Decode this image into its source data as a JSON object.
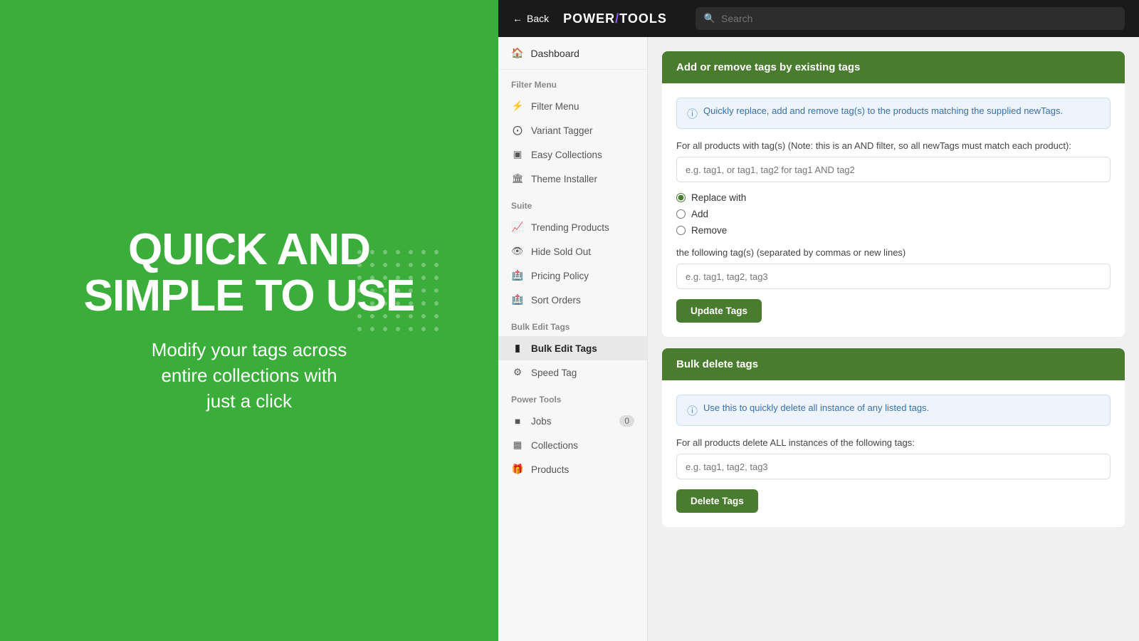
{
  "left": {
    "title_line1": "QUICK AND",
    "title_line2": "SIMPLE TO USE",
    "subtitle_line1": "Modify your tags across",
    "subtitle_line2": "entire collections with",
    "subtitle_line3": "just a click"
  },
  "topbar": {
    "back_label": "Back",
    "logo": "POWER",
    "logo_slash": "/",
    "logo_end": "TOOLS",
    "search_placeholder": "Search"
  },
  "sidebar": {
    "dashboard_label": "Dashboard",
    "filter_menu_header": "Filter Menu",
    "filter_menu_items": [
      {
        "label": "Filter Menu",
        "icon": "filter"
      },
      {
        "label": "Variant Tagger",
        "icon": "tag"
      },
      {
        "label": "Easy Collections",
        "icon": "collection"
      },
      {
        "label": "Theme Installer",
        "icon": "theme"
      }
    ],
    "suite_header": "Suite",
    "suite_items": [
      {
        "label": "Trending Products",
        "icon": "trending"
      },
      {
        "label": "Hide Sold Out",
        "icon": "hide"
      },
      {
        "label": "Pricing Policy",
        "icon": "pricing"
      },
      {
        "label": "Sort Orders",
        "icon": "sort"
      }
    ],
    "bulk_edit_header": "Bulk Edit Tags",
    "bulk_edit_items": [
      {
        "label": "Bulk Edit Tags",
        "icon": "bulk",
        "active": true
      },
      {
        "label": "Speed Tag",
        "icon": "speed"
      }
    ],
    "power_tools_header": "Power Tools",
    "power_tools_items": [
      {
        "label": "Jobs",
        "icon": "jobs",
        "badge": "0"
      },
      {
        "label": "Collections",
        "icon": "collections"
      },
      {
        "label": "Products",
        "icon": "products"
      }
    ]
  },
  "main": {
    "add_remove_section": {
      "header": "Add or remove tags by existing tags",
      "info_text": "Quickly replace, add and remove tag(s) to the products matching the supplied newTags.",
      "existing_tags_label": "For all products with tag(s) (Note: this is an AND filter, so all newTags must match each product):",
      "existing_tags_placeholder": "e.g. tag1, or tag1, tag2 for tag1 AND tag2",
      "radio_options": [
        "Replace with",
        "Add",
        "Remove"
      ],
      "radio_selected": "Replace with",
      "following_tags_label": "the following tag(s) (separated by commas or new lines)",
      "following_tags_placeholder": "e.g. tag1, tag2, tag3",
      "update_button": "Update Tags"
    },
    "bulk_delete_section": {
      "header": "Bulk delete tags",
      "info_text": "Use this to quickly delete all instance of any listed tags.",
      "delete_label": "For all products delete ALL instances of the following tags:",
      "delete_placeholder": "e.g. tag1, tag2, tag3",
      "delete_button": "Delete Tags"
    }
  }
}
